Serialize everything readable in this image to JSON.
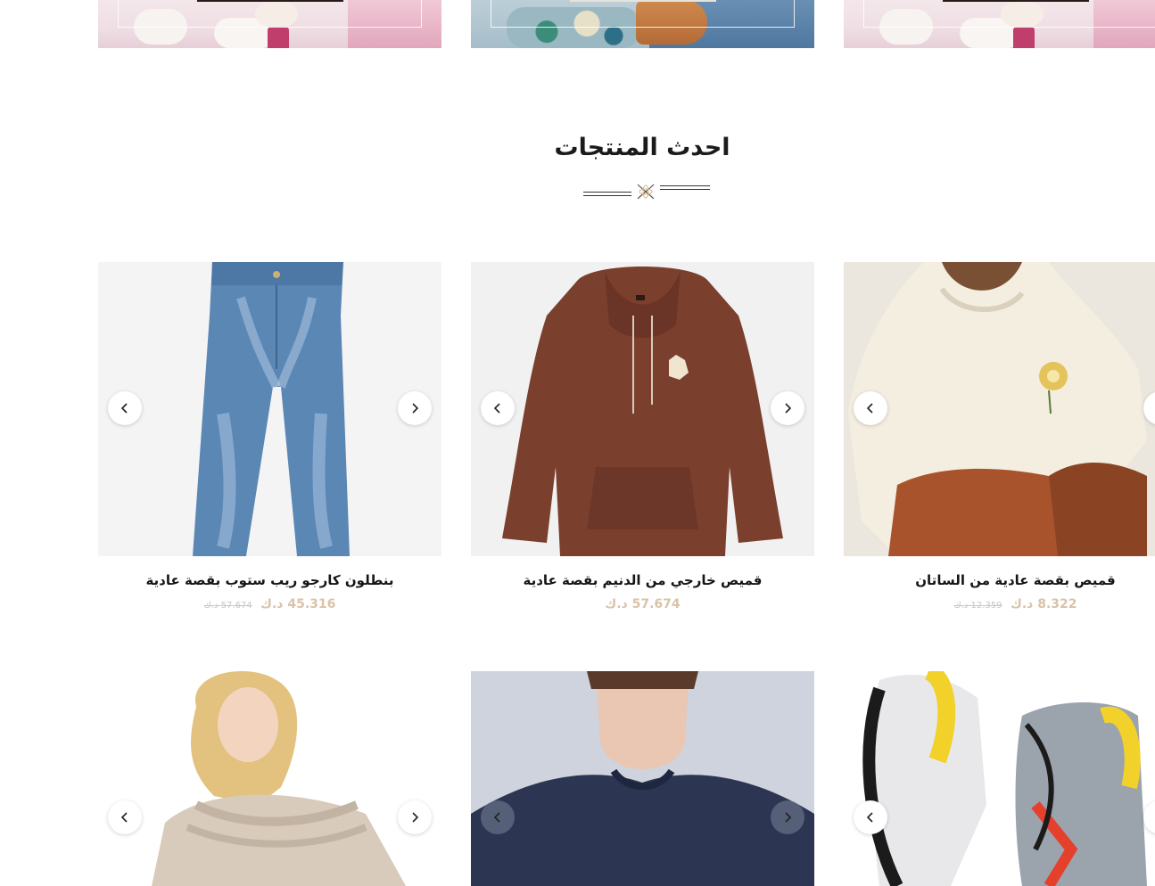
{
  "section": {
    "title": "احدث المنتجات"
  },
  "products": [
    {
      "name": "بنطلون كارجو ريب ستوب بقصة عادية",
      "price": "45.316 د.ك",
      "old_price": "57.674 د.ك"
    },
    {
      "name": "قميص خارجي من الدنيم بقصة عادية",
      "price": "57.674 د.ك",
      "old_price": ""
    },
    {
      "name": "قميص بقصة عادية من الساتان",
      "price": "8.322 د.ك",
      "old_price": "12.359 د.ك"
    }
  ],
  "colors": {
    "price": "#d9c3a9",
    "old_price": "#c7c7c7",
    "title": "#1b1b1b"
  },
  "icons": {
    "prev": "chevron-left-icon",
    "next": "chevron-right-icon",
    "divider": "flourish-icon"
  }
}
